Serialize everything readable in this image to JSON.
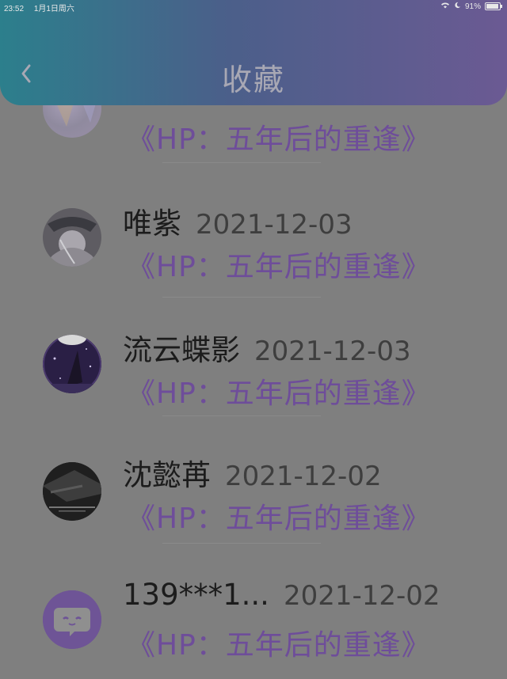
{
  "status_bar": {
    "time": "23:52",
    "date": "1月1日周六",
    "battery": "91%",
    "battery_level": 0.91
  },
  "header": {
    "title": "收藏"
  },
  "items": [
    {
      "name": "",
      "date": "",
      "book": "《HP：五年后的重逢》"
    },
    {
      "name": "唯紫",
      "date": "2021-12-03",
      "book": "《HP：五年后的重逢》"
    },
    {
      "name": "流云蝶影",
      "date": "2021-12-03",
      "book": "《HP：五年后的重逢》"
    },
    {
      "name": "沈懿苒",
      "date": "2021-12-02",
      "book": "《HP：五年后的重逢》"
    },
    {
      "name": "139***1...",
      "date": "2021-12-02",
      "book": "《HP：五年后的重逢》"
    }
  ]
}
